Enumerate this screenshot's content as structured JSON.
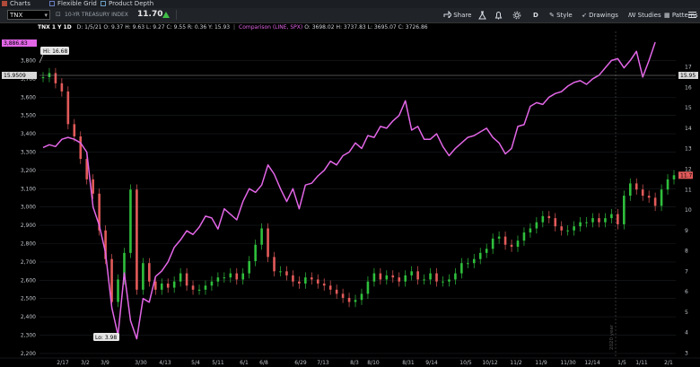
{
  "tabs": [
    {
      "label": "Charts"
    },
    {
      "label": "Flexible Grid"
    },
    {
      "label": "Product Depth"
    }
  ],
  "toolbar": {
    "symbol": "TNX",
    "security_name": "10-YR TREASURY INDEX",
    "last": "11.70",
    "buttons": {
      "share": "Share",
      "period": "D",
      "style": "Style",
      "drawings": "Drawings",
      "studies": "Studies",
      "patterns": "Patterns"
    }
  },
  "legend": {
    "symbol": "TNX 1 Y 1D",
    "date": "D: 1/5/21",
    "open": "O: 9.37",
    "high": "H: 9.63",
    "low": "L: 9.27",
    "close": "C: 9.55",
    "r": "R: 0.36",
    "y": "Y: 15.93",
    "comparison": "Comparison (LINE, SPX)",
    "cmp_open": "O: 3698.02",
    "cmp_high": "H: 3737.83",
    "cmp_low": "L: 3695.07",
    "cmp_close": "C: 3726.86"
  },
  "colors": {
    "spx_line": "#e366e7",
    "up": "#2fbf3c",
    "down": "#e35a5a",
    "axis_text": "#bfc4c9",
    "bg": "#000000"
  },
  "chart_data": {
    "type": "line",
    "x_labels": [
      "2/17",
      "3/2",
      "3/9",
      "3/30",
      "4/13",
      "5/4",
      "5/11",
      "6/1",
      "6/8",
      "6/29",
      "7/13",
      "8/3",
      "8/10",
      "8/31",
      "9/14",
      "10/5",
      "10/12",
      "11/2",
      "11/9",
      "11/30",
      "12/14",
      "1/5",
      "1/11",
      "2/1"
    ],
    "left_axis": {
      "ticks": [
        3800,
        3700,
        3600,
        3500,
        3400,
        3300,
        3200,
        3100,
        3000,
        2900,
        2800,
        2700,
        2600,
        2500,
        2400,
        2300,
        2200
      ],
      "ylim": [
        2180,
        3910
      ]
    },
    "right_axis": {
      "ticks": [
        17,
        16,
        15,
        14,
        13,
        12,
        11,
        10,
        9,
        8,
        7,
        6,
        5,
        4,
        3
      ],
      "ylim": [
        2.8,
        18.3
      ]
    },
    "left_badges": {
      "top": "3,886.83",
      "cursor": "15.9509"
    },
    "right_badges": {
      "cursor": "15.95",
      "last": "11.7"
    },
    "annotations": {
      "hi": "Hi: 16.68",
      "lo": "Lo: 3.98",
      "year_marker": "2020 year"
    },
    "series": [
      {
        "name": "SPX",
        "axis": "left",
        "values": [
          3325,
          3340,
          3330,
          3370,
          3380,
          3370,
          3350,
          3300,
          3000,
          2900,
          2750,
          2450,
          2300,
          2640,
          2380,
          2280,
          2500,
          2480,
          2620,
          2650,
          2700,
          2780,
          2820,
          2870,
          2850,
          2890,
          2950,
          2940,
          2880,
          2990,
          2960,
          2930,
          3030,
          3100,
          3080,
          3120,
          3230,
          3180,
          3100,
          3030,
          3100,
          2990,
          3120,
          3130,
          3170,
          3200,
          3250,
          3230,
          3280,
          3300,
          3350,
          3320,
          3390,
          3380,
          3440,
          3430,
          3470,
          3500,
          3580,
          3420,
          3440,
          3370,
          3370,
          3400,
          3330,
          3280,
          3320,
          3350,
          3380,
          3390,
          3410,
          3430,
          3380,
          3350,
          3290,
          3320,
          3440,
          3450,
          3550,
          3570,
          3560,
          3600,
          3620,
          3630,
          3660,
          3680,
          3690,
          3670,
          3700,
          3720,
          3760,
          3800,
          3810,
          3760,
          3800,
          3850,
          3710,
          3800,
          3900
        ]
      },
      {
        "name": "TNX",
        "axis": "right",
        "candles": true,
        "values": [
          16.5,
          16.7,
          16.2,
          15.8,
          14.2,
          13.6,
          12.5,
          11.5,
          10.8,
          9.0,
          7.6,
          5.5,
          6.6,
          7.9,
          11.0,
          6.1,
          7.4,
          6.5,
          6.1,
          6.4,
          6.2,
          6.5,
          6.9,
          6.3,
          6.1,
          6.1,
          6.3,
          6.5,
          6.7,
          6.7,
          6.9,
          6.6,
          6.9,
          7.5,
          8.3,
          9.1,
          7.7,
          7.0,
          7.0,
          6.8,
          6.5,
          6.4,
          6.7,
          6.6,
          6.4,
          6.3,
          6.1,
          5.9,
          5.7,
          5.5,
          5.6,
          5.9,
          6.5,
          6.9,
          6.6,
          6.8,
          6.7,
          6.5,
          6.8,
          7.0,
          6.6,
          6.6,
          6.9,
          6.5,
          6.5,
          6.6,
          6.9,
          7.4,
          7.4,
          7.6,
          7.9,
          8.1,
          8.6,
          8.7,
          8.3,
          8.2,
          8.5,
          8.9,
          9.1,
          9.4,
          9.7,
          9.6,
          9.2,
          9.0,
          9.0,
          9.2,
          9.4,
          9.4,
          9.6,
          9.4,
          9.6,
          9.8,
          9.3,
          10.7,
          11.3,
          11.0,
          10.7,
          10.6,
          10.2,
          11.0,
          11.5,
          11.7
        ]
      }
    ]
  }
}
